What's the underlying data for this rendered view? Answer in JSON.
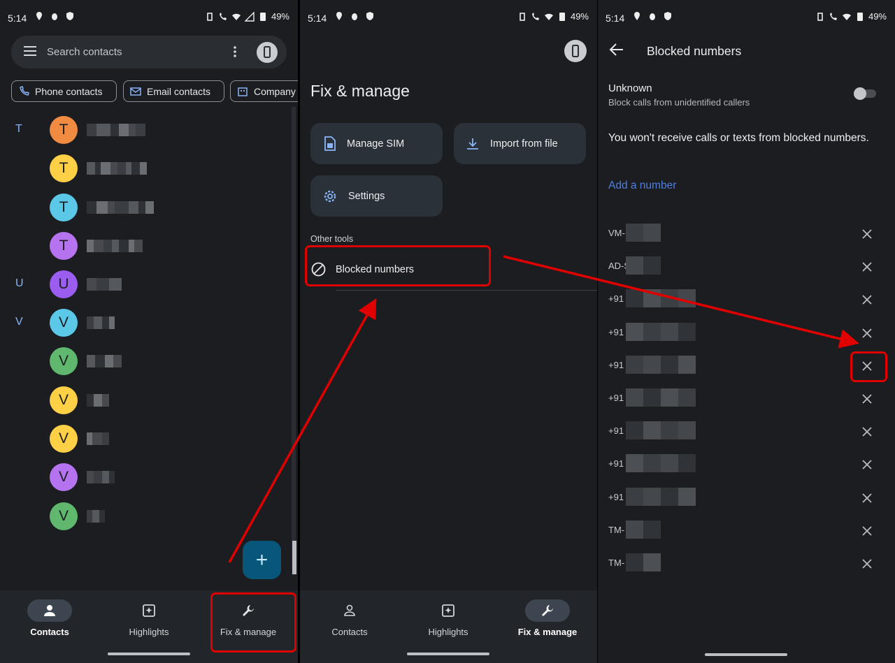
{
  "status": {
    "time": "5:14",
    "battery": "49%"
  },
  "contacts_screen": {
    "search_placeholder": "Search contacts",
    "chips": [
      "Phone contacts",
      "Email contacts",
      "Company"
    ],
    "contacts": [
      {
        "section": "T",
        "initial": "T",
        "color": "#f28b42"
      },
      {
        "section": "",
        "initial": "T",
        "color": "#fdd046"
      },
      {
        "section": "",
        "initial": "T",
        "color": "#5bc8e8"
      },
      {
        "section": "",
        "initial": "T",
        "color": "#b573f0"
      },
      {
        "section": "U",
        "initial": "U",
        "color": "#9b5df0"
      },
      {
        "section": "V",
        "initial": "V",
        "color": "#5bc8e8"
      },
      {
        "section": "",
        "initial": "V",
        "color": "#5fb86e"
      },
      {
        "section": "",
        "initial": "V",
        "color": "#fdd046"
      },
      {
        "section": "",
        "initial": "V",
        "color": "#fdd046"
      },
      {
        "section": "",
        "initial": "V",
        "color": "#b573f0"
      },
      {
        "section": "",
        "initial": "V",
        "color": "#5fb86e"
      }
    ],
    "fab_label": "+"
  },
  "nav": {
    "contacts": "Contacts",
    "highlights": "Highlights",
    "fix_manage": "Fix & manage"
  },
  "fix_screen": {
    "title": "Fix & manage",
    "manage_sim": "Manage SIM",
    "import_from_file": "Import from file",
    "settings": "Settings",
    "other_tools": "Other tools",
    "blocked_numbers": "Blocked numbers"
  },
  "blocked_screen": {
    "title": "Blocked numbers",
    "unknown_title": "Unknown",
    "unknown_subtitle": "Block calls from unidentified callers",
    "info": "You won't receive calls or texts from blocked numbers.",
    "add_number": "Add a number",
    "numbers": [
      "VM-",
      "AD-S",
      "+91",
      "+91",
      "+91",
      "+91",
      "+91",
      "+91",
      "+91",
      "TM-",
      "TM-"
    ]
  },
  "colors": {
    "accent_red": "#e00000",
    "link_blue": "#4f7fe0",
    "fab": "#08577a",
    "section_letter": "#8ab4f8"
  }
}
